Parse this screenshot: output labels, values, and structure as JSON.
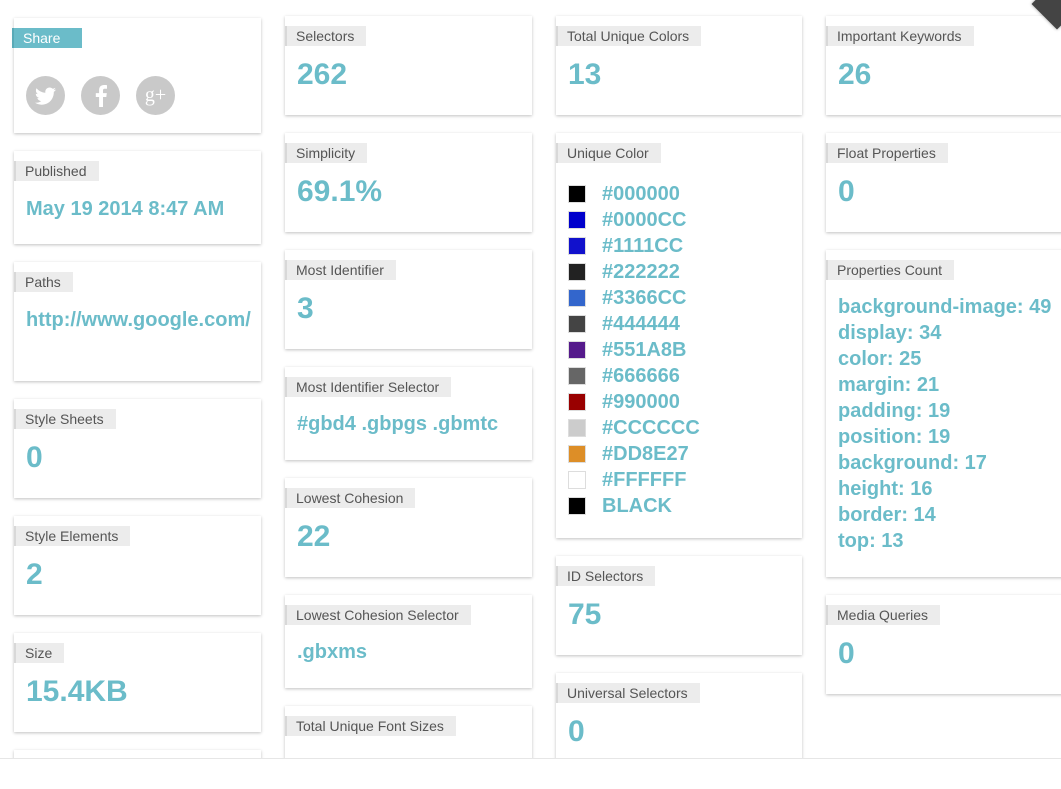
{
  "share": {
    "label": "Share",
    "icons": [
      "twitter-icon",
      "facebook-icon",
      "google-plus-icon"
    ],
    "glyphs": [
      "t",
      "f",
      "g+"
    ]
  },
  "published": {
    "label": "Published",
    "value": "May 19 2014 8:47 AM"
  },
  "paths": {
    "label": "Paths",
    "value": "http://www.google.com/"
  },
  "style_sheets": {
    "label": "Style Sheets",
    "value": "0"
  },
  "style_elements": {
    "label": "Style Elements",
    "value": "2"
  },
  "size": {
    "label": "Size",
    "value": "15.4KB"
  },
  "selectors": {
    "label": "Selectors",
    "value": "262"
  },
  "simplicity": {
    "label": "Simplicity",
    "value": "69.1%"
  },
  "most_identifier": {
    "label": "Most Identifier",
    "value": "3"
  },
  "most_identifier_selector": {
    "label": "Most Identifier Selector",
    "value": "#gbd4 .gbpgs .gbmtc"
  },
  "lowest_cohesion": {
    "label": "Lowest Cohesion",
    "value": "22"
  },
  "lowest_cohesion_selector": {
    "label": "Lowest Cohesion Selector",
    "value": ".gbxms"
  },
  "total_unique_font_sizes": {
    "label": "Total Unique Font Sizes",
    "value": ""
  },
  "total_unique_colors": {
    "label": "Total Unique Colors",
    "value": "13"
  },
  "unique_color": {
    "label": "Unique Color",
    "items": [
      {
        "name": "#000000",
        "color": "#000000"
      },
      {
        "name": "#0000CC",
        "color": "#0000CC"
      },
      {
        "name": "#1111CC",
        "color": "#1111CC"
      },
      {
        "name": "#222222",
        "color": "#222222"
      },
      {
        "name": "#3366CC",
        "color": "#3366CC"
      },
      {
        "name": "#444444",
        "color": "#444444"
      },
      {
        "name": "#551A8B",
        "color": "#551A8B"
      },
      {
        "name": "#666666",
        "color": "#666666"
      },
      {
        "name": "#990000",
        "color": "#990000"
      },
      {
        "name": "#CCCCCC",
        "color": "#CCCCCC"
      },
      {
        "name": "#DD8E27",
        "color": "#DD8E27"
      },
      {
        "name": "#FFFFFF",
        "color": "#FFFFFF"
      },
      {
        "name": "BLACK",
        "color": "#000000"
      }
    ]
  },
  "id_selectors": {
    "label": "ID Selectors",
    "value": "75"
  },
  "universal_selectors": {
    "label": "Universal Selectors",
    "value": "0"
  },
  "important_keywords": {
    "label": "Important Keywords",
    "value": "26"
  },
  "float_properties": {
    "label": "Float Properties",
    "value": "0"
  },
  "properties_count": {
    "label": "Properties Count",
    "items": [
      "background-image: 49",
      "display: 34",
      "color: 25",
      "margin: 21",
      "padding: 19",
      "position: 19",
      "background: 17",
      "height: 16",
      "border: 14",
      "top: 13"
    ]
  },
  "media_queries": {
    "label": "Media Queries",
    "value": "0"
  },
  "accent_color": "#6bbcc9"
}
